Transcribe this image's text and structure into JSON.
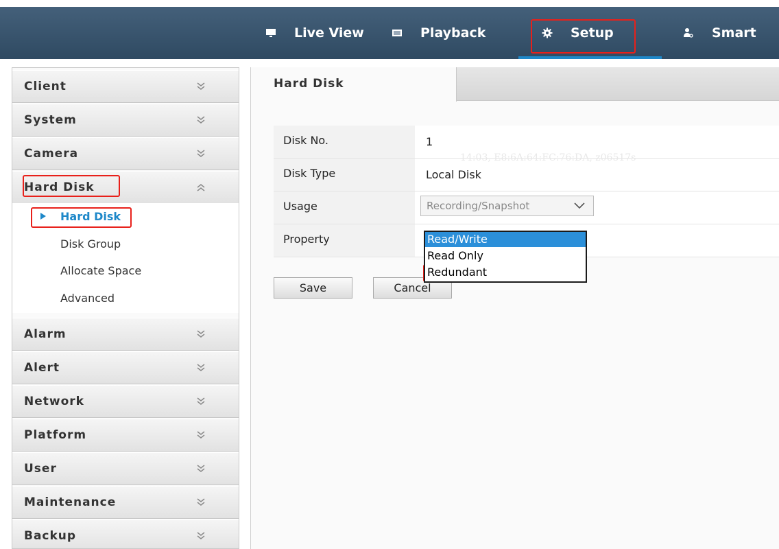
{
  "nav": {
    "items": [
      {
        "label": "Live View",
        "icon": "monitor-icon"
      },
      {
        "label": "Playback",
        "icon": "film-icon"
      },
      {
        "label": "Setup",
        "icon": "gear-icon"
      },
      {
        "label": "Smart",
        "icon": "person-search-icon"
      }
    ],
    "active": "Setup"
  },
  "sidebar": {
    "items": [
      {
        "label": "Client",
        "expanded": false
      },
      {
        "label": "System",
        "expanded": false
      },
      {
        "label": "Camera",
        "expanded": false
      },
      {
        "label": "Hard Disk",
        "expanded": true
      },
      {
        "label": "Alarm",
        "expanded": false
      },
      {
        "label": "Alert",
        "expanded": false
      },
      {
        "label": "Network",
        "expanded": false
      },
      {
        "label": "Platform",
        "expanded": false
      },
      {
        "label": "User",
        "expanded": false
      },
      {
        "label": "Maintenance",
        "expanded": false
      },
      {
        "label": "Backup",
        "expanded": false
      }
    ],
    "subitems": [
      {
        "label": "Hard Disk",
        "active": true
      },
      {
        "label": "Disk Group",
        "active": false
      },
      {
        "label": "Allocate Space",
        "active": false
      },
      {
        "label": "Advanced",
        "active": false
      }
    ]
  },
  "content": {
    "tab": "Hard Disk",
    "rows": [
      {
        "label": "Disk No.",
        "value": "1"
      },
      {
        "label": "Disk Type",
        "value": "Local Disk"
      },
      {
        "label": "Usage",
        "value": "Recording/Snapshot"
      },
      {
        "label": "Property",
        "value": "Read/Write"
      }
    ],
    "watermark": "14:03, E8:6A:64:FC:76:DA, z06517s",
    "property_options": [
      "Read/Write",
      "Read Only",
      "Redundant"
    ],
    "property_selected": "Read/Write",
    "save_label": "Save",
    "cancel_label": "Cancel"
  },
  "colors": {
    "accent": "#1e88c9",
    "highlight": "#e8201a",
    "topbar": "#3a556e",
    "option_selected": "#2b8fd9"
  }
}
